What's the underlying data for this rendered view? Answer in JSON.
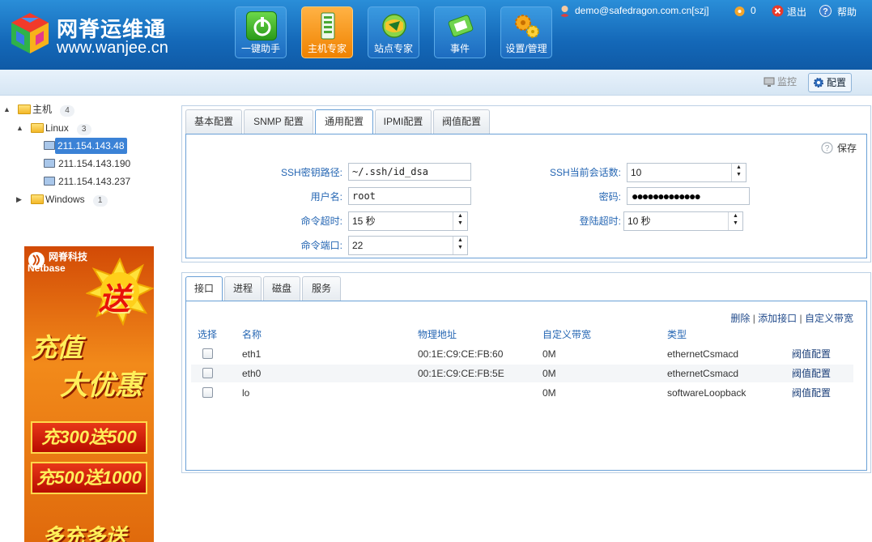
{
  "brand": {
    "title": "网脊运维通",
    "url": "www.wanjee.cn"
  },
  "nav": [
    {
      "label": "一键助手",
      "icon": "power-icon",
      "active": false
    },
    {
      "label": "主机专家",
      "icon": "server-icon",
      "active": true
    },
    {
      "label": "站点专家",
      "icon": "globe-icon",
      "active": false
    },
    {
      "label": "事件",
      "icon": "event-icon",
      "active": false
    },
    {
      "label": "设置/管理",
      "icon": "gears-icon",
      "active": false
    }
  ],
  "user": {
    "account": "demo@safedragon.com.cn[szj]",
    "alerts": "0",
    "logout": "退出",
    "help": "帮助"
  },
  "toolbar": {
    "monitor": "监控",
    "config": "配置"
  },
  "tree": {
    "root": {
      "label": "主机",
      "count": "4"
    },
    "linux": {
      "label": "Linux",
      "count": "3"
    },
    "hosts": [
      "211.154.143.48",
      "211.154.143.190",
      "211.154.143.237"
    ],
    "windows": {
      "label": "Windows",
      "count": "1"
    }
  },
  "ad": {
    "brand_cn": "网脊科技",
    "brand_en": "Netbase",
    "burst": "送",
    "line1": "充值",
    "line2": "大优惠",
    "offer1": "充300送500",
    "offer2": "充500送1000",
    "footer": "多充多送"
  },
  "config_tabs": [
    "基本配置",
    "SNMP 配置",
    "通用配置",
    "IPMI配置",
    "阀值配置"
  ],
  "config_active_tab": 2,
  "save_label": "保存",
  "form": {
    "ssh_key_path": {
      "label": "SSH密钥路径:",
      "value": "~/.ssh/id_dsa"
    },
    "ssh_sessions": {
      "label": "SSH当前会话数:",
      "value": "10"
    },
    "username": {
      "label": "用户名:",
      "value": "root"
    },
    "password": {
      "label": "密码:",
      "value": "●●●●●●●●●●●●●"
    },
    "cmd_timeout": {
      "label": "命令超时:",
      "value": "15 秒"
    },
    "login_timeout": {
      "label": "登陆超时:",
      "value": "10 秒"
    },
    "cmd_port": {
      "label": "命令端口:",
      "value": "22"
    }
  },
  "detail_tabs": [
    "接口",
    "进程",
    "磁盘",
    "服务"
  ],
  "detail_active_tab": 0,
  "table_actions": {
    "delete": "删除",
    "add": "添加接口",
    "custom": "自定义带宽",
    "sep": "|"
  },
  "table": {
    "headers": [
      "选择",
      "名称",
      "物理地址",
      "自定义带宽",
      "类型"
    ],
    "rows": [
      {
        "name": "eth1",
        "mac": "00:1E:C9:CE:FB:60",
        "bandwidth": "0M",
        "type": "ethernetCsmacd",
        "action": "阀值配置"
      },
      {
        "name": "eth0",
        "mac": "00:1E:C9:CE:FB:5E",
        "bandwidth": "0M",
        "type": "ethernetCsmacd",
        "action": "阀值配置"
      },
      {
        "name": "lo",
        "mac": "",
        "bandwidth": "0M",
        "type": "softwareLoopback",
        "action": "阀值配置"
      }
    ]
  }
}
